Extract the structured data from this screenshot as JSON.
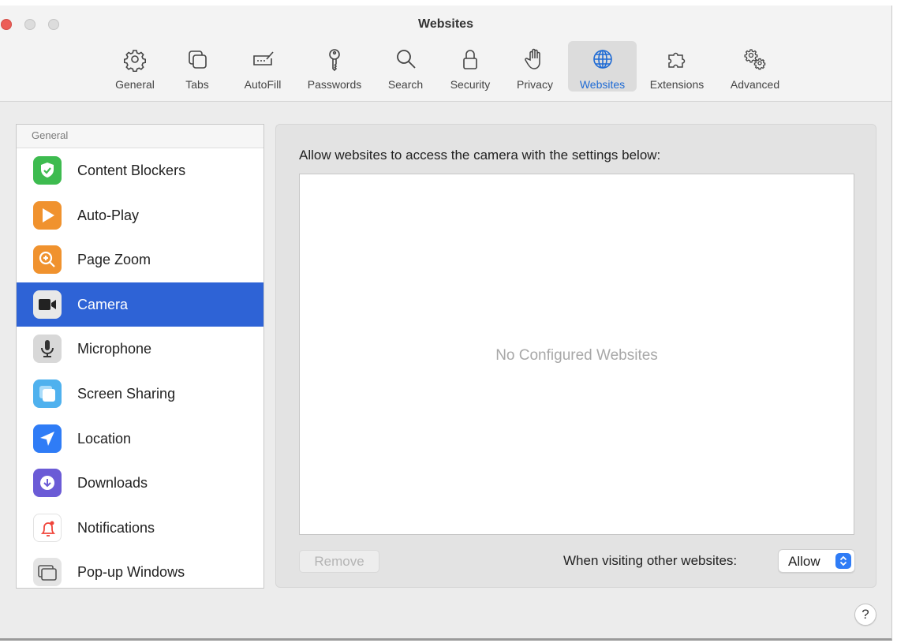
{
  "window": {
    "title": "Websites"
  },
  "toolbar": {
    "tabs": [
      {
        "label": "General",
        "icon": "gear-icon"
      },
      {
        "label": "Tabs",
        "icon": "tabs-icon"
      },
      {
        "label": "AutoFill",
        "icon": "autofill-icon"
      },
      {
        "label": "Passwords",
        "icon": "key-icon"
      },
      {
        "label": "Search",
        "icon": "search-icon"
      },
      {
        "label": "Security",
        "icon": "lock-icon"
      },
      {
        "label": "Privacy",
        "icon": "hand-icon"
      },
      {
        "label": "Websites",
        "icon": "globe-icon",
        "active": true
      },
      {
        "label": "Extensions",
        "icon": "puzzle-icon"
      },
      {
        "label": "Advanced",
        "icon": "gears-icon"
      }
    ]
  },
  "sidebar": {
    "header": "General",
    "items": [
      {
        "label": "Content Blockers",
        "icon": "shield-check-icon",
        "color": "#3dbb4f"
      },
      {
        "label": "Auto-Play",
        "icon": "play-icon",
        "color": "#f0922e"
      },
      {
        "label": "Page Zoom",
        "icon": "zoom-icon",
        "color": "#f0922e"
      },
      {
        "label": "Camera",
        "icon": "camera-icon",
        "color": "#3a3a3a",
        "selected": true
      },
      {
        "label": "Microphone",
        "icon": "microphone-icon",
        "color": "#5f5f5f"
      },
      {
        "label": "Screen Sharing",
        "icon": "screen-sharing-icon",
        "color": "#4fb1ee"
      },
      {
        "label": "Location",
        "icon": "location-icon",
        "color": "#2f7cf6"
      },
      {
        "label": "Downloads",
        "icon": "download-icon",
        "color": "#6b5bd6"
      },
      {
        "label": "Notifications",
        "icon": "bell-icon",
        "color": "#f0443a"
      },
      {
        "label": "Pop-up Windows",
        "icon": "popup-windows-icon",
        "color": "#8a8a8a"
      }
    ]
  },
  "panel": {
    "description": "Allow websites to access the camera with the settings below:",
    "empty_text": "No Configured Websites",
    "remove_label": "Remove",
    "visiting_label": "When visiting other websites:",
    "visiting_value": "Allow"
  },
  "help": {
    "label": "?"
  },
  "colors": {
    "accent": "#2e63d6",
    "active_tab_text": "#1f6bd4"
  }
}
